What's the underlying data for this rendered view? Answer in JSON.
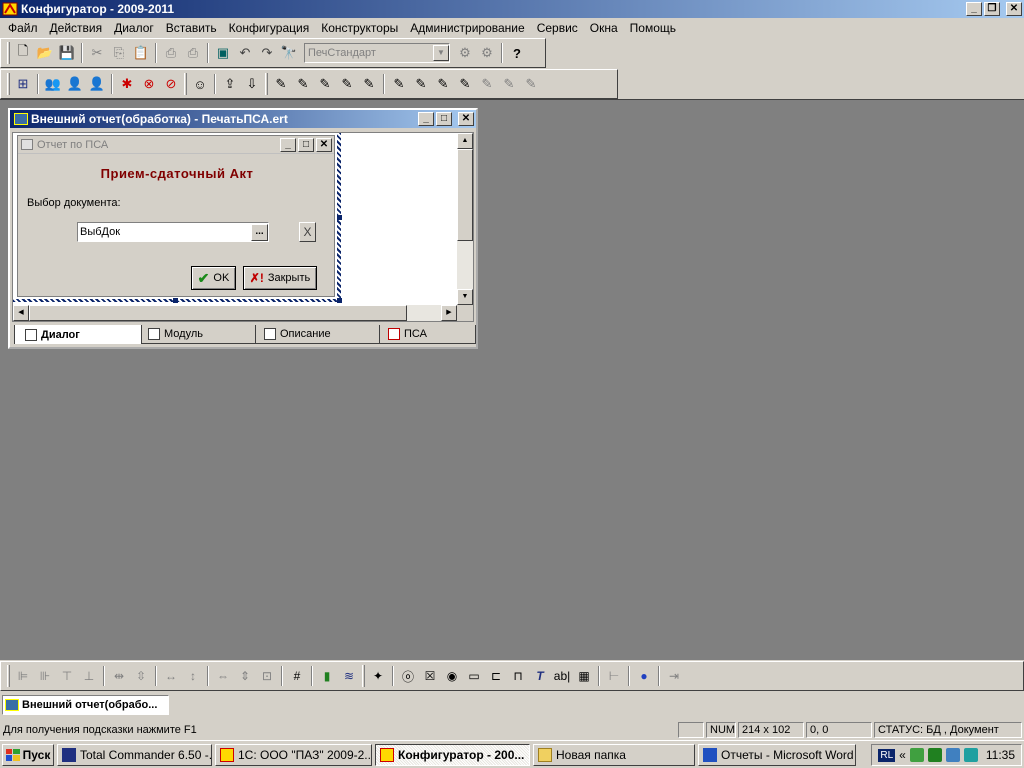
{
  "app": {
    "title": "Конфигуратор - 2009-2011"
  },
  "menu": [
    "Файл",
    "Действия",
    "Диалог",
    "Вставить",
    "Конфигурация",
    "Конструкторы",
    "Администрирование",
    "Сервис",
    "Окна",
    "Помощь"
  ],
  "toolbar1": {
    "combo_value": "ПечСтандарт"
  },
  "child": {
    "title": "Внешний отчет(обработка) - ПечатьПСА.ert",
    "form": {
      "title": "Отчет по ПСА",
      "heading": "Прием-сдаточный Акт",
      "label": "Выбор документа:",
      "input_value": "ВыбДок",
      "ellipsis": "...",
      "clear": "X",
      "ok_label": "OK",
      "close_label": "Закрыть"
    },
    "tabs": [
      "Диалог",
      "Модуль",
      "Описание",
      "ПСА"
    ]
  },
  "winlist": {
    "item": "Внешний отчет(обрабо..."
  },
  "status": {
    "hint": "Для получения подсказки нажмите F1",
    "num": "NUM",
    "size": "214 x 102",
    "pos": "0, 0",
    "state": "СТАТУС: БД , Документ"
  },
  "taskbar": {
    "start": "Пуск",
    "tasks": [
      "Total Commander 6.50 -...",
      "1С: ООО \"ПАЗ\" 2009-2...",
      "Конфигуратор - 200...",
      "Новая папка",
      "Отчеты - Microsoft Word"
    ],
    "lang": "RL",
    "time": "11:35"
  },
  "colors": {
    "titlebar": "#0a246a",
    "workspace": "#808080",
    "heading": "#800000"
  }
}
